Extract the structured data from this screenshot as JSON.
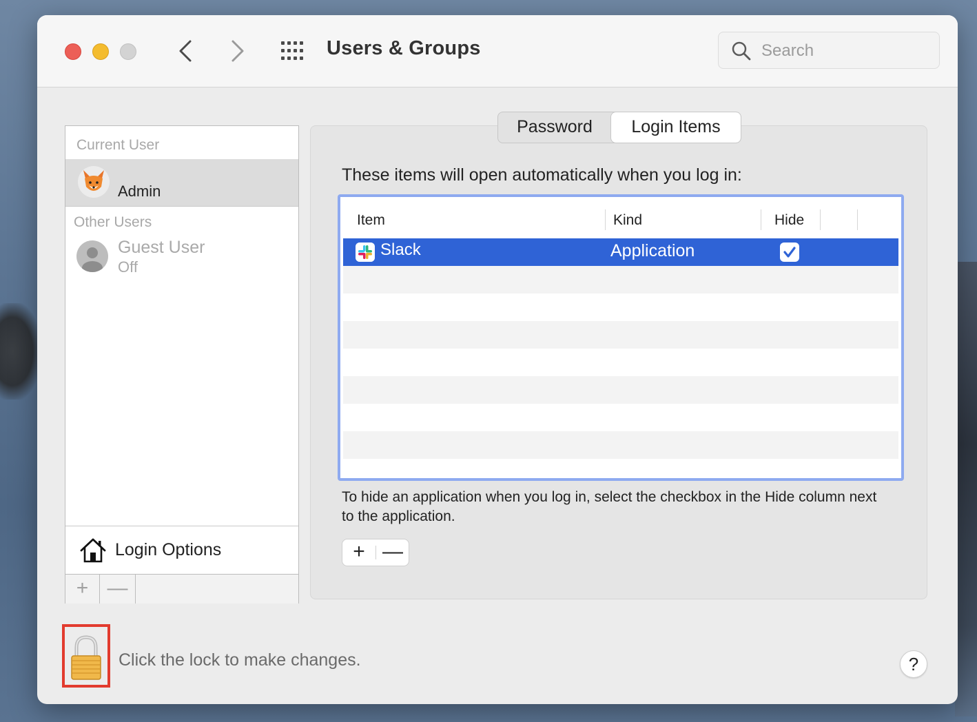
{
  "window": {
    "title": "Users & Groups",
    "search_placeholder": "Search"
  },
  "sidebar": {
    "current_user_label": "Current User",
    "current_user": {
      "name": "Admin",
      "avatar": "fox-emoji"
    },
    "other_users_label": "Other Users",
    "other_users": [
      {
        "name": "Guest User",
        "status": "Off"
      }
    ],
    "login_options_label": "Login Options",
    "footer_add": "+",
    "footer_remove": "—"
  },
  "tabs": [
    "Password",
    "Login Items"
  ],
  "active_tab": "Login Items",
  "login_items": {
    "intro": "These items will open automatically when you log in:",
    "columns": [
      "Item",
      "Kind",
      "Hide"
    ],
    "rows": [
      {
        "item": "Slack",
        "kind": "Application",
        "hide": true,
        "selected": true
      }
    ],
    "help": "To hide an application when you log in, select the checkbox in the Hide column next to the application.",
    "add": "+",
    "remove": "—"
  },
  "footer": {
    "lock_text": "Click the lock to make changes.",
    "help": "?"
  },
  "colors": {
    "close": "#ec5f57",
    "minimize": "#f4bc2f",
    "maximize": "#d3d3d3",
    "selection": "#2f63d6",
    "table_focus_ring": "#8eaaf0",
    "lock_highlight": "#e23b2e"
  }
}
